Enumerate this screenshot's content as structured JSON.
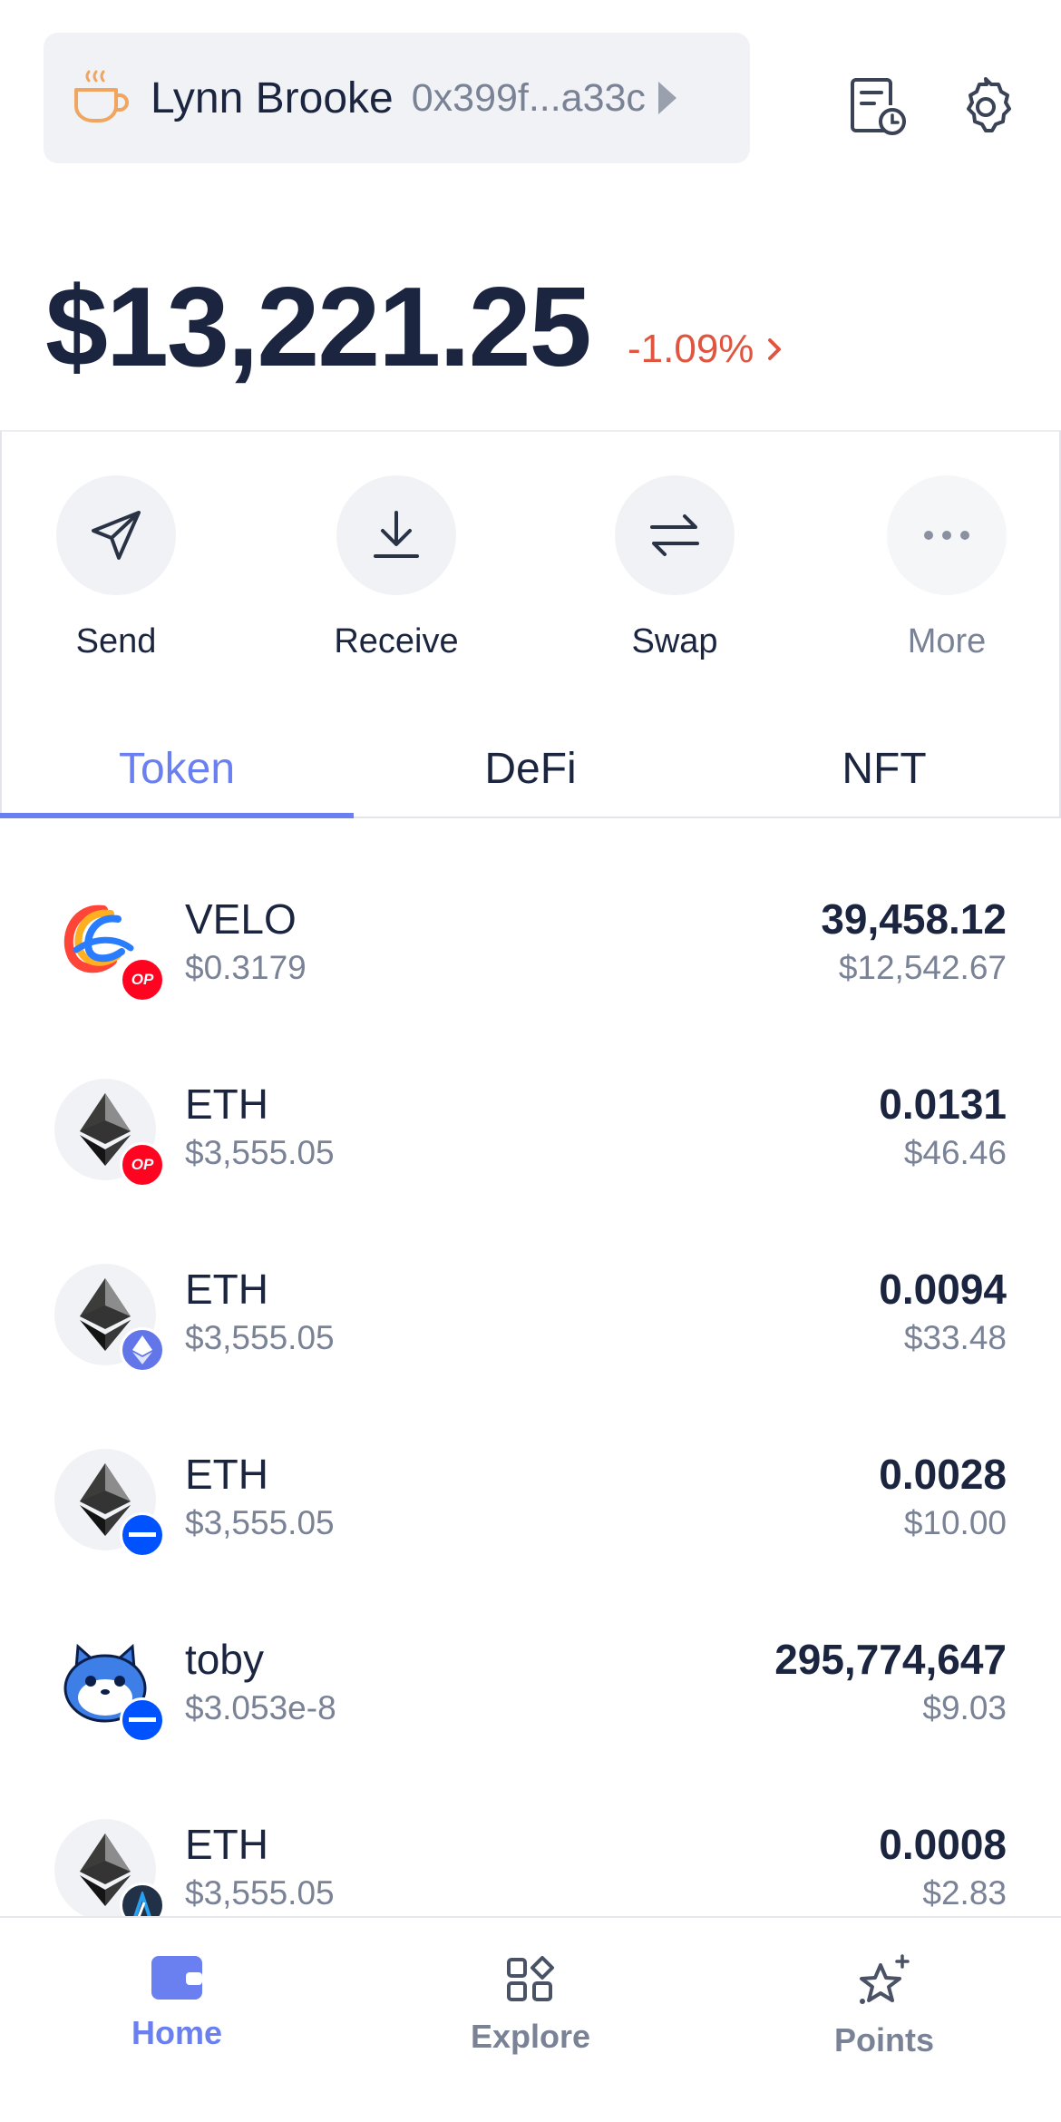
{
  "header": {
    "account_name": "Lynn Brooke",
    "account_address": "0x399f...a33c",
    "icons": [
      "coffee-cup-icon",
      "history-icon",
      "gear-icon"
    ]
  },
  "balance": {
    "total": "$13,221.25",
    "change": "-1.09%",
    "change_color": "#e0553f"
  },
  "actions": [
    {
      "label": "Send",
      "icon": "send-icon"
    },
    {
      "label": "Receive",
      "icon": "download-icon"
    },
    {
      "label": "Swap",
      "icon": "swap-icon"
    },
    {
      "label": "More",
      "icon": "more-icon"
    }
  ],
  "tabs": [
    {
      "label": "Token",
      "active": true
    },
    {
      "label": "DeFi",
      "active": false
    },
    {
      "label": "NFT",
      "active": false
    }
  ],
  "tokens": [
    {
      "symbol": "VELO",
      "price": "$0.3179",
      "amount": "39,458.12",
      "value": "$12,542.67",
      "icon": "velo-icon",
      "chain": "optimism"
    },
    {
      "symbol": "ETH",
      "price": "$3,555.05",
      "amount": "0.0131",
      "value": "$46.46",
      "icon": "eth-icon",
      "chain": "optimism"
    },
    {
      "symbol": "ETH",
      "price": "$3,555.05",
      "amount": "0.0094",
      "value": "$33.48",
      "icon": "eth-icon",
      "chain": "ethereum"
    },
    {
      "symbol": "ETH",
      "price": "$3,555.05",
      "amount": "0.0028",
      "value": "$10.00",
      "icon": "eth-icon",
      "chain": "base"
    },
    {
      "symbol": "toby",
      "price": "$3.053e-8",
      "amount": "295,774,647",
      "value": "$9.03",
      "icon": "toby-icon",
      "chain": "base"
    },
    {
      "symbol": "ETH",
      "price": "$3,555.05",
      "amount": "0.0008",
      "value": "$2.83",
      "icon": "eth-icon",
      "chain": "arbitrum"
    }
  ],
  "badges": {
    "op": "OP"
  },
  "bottom_nav": [
    {
      "label": "Home",
      "icon": "wallet-icon",
      "active": true
    },
    {
      "label": "Explore",
      "icon": "explore-grid-icon",
      "active": false
    },
    {
      "label": "Points",
      "icon": "sparkle-star-icon",
      "active": false
    }
  ],
  "colors": {
    "accent": "#6a7ff0",
    "text": "#1b2540",
    "muted": "#7a8296",
    "negative": "#e0553f"
  }
}
